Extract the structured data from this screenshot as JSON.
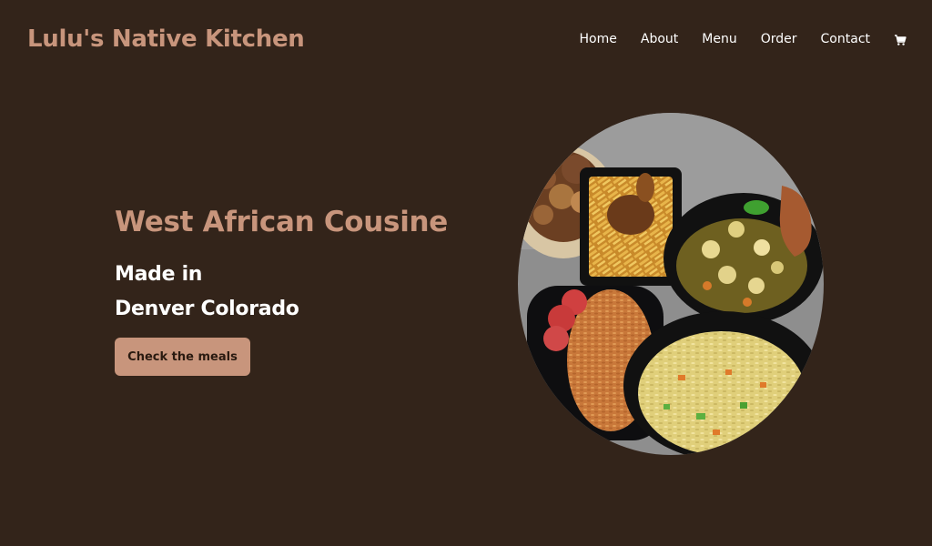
{
  "header": {
    "brand": "Lulu's Native Kitchen",
    "nav": [
      "Home",
      "About",
      "Menu",
      "Order",
      "Contact"
    ],
    "cart_icon": "cart-icon"
  },
  "hero": {
    "title": "West African Cousine",
    "subtitle_line1": "Made in",
    "subtitle_line2": "Denver Colorado",
    "cta_label": "Check the meals",
    "image": "food-platter-image"
  },
  "colors": {
    "background": "#33241a",
    "accent": "#c8957c",
    "text": "#ffffff"
  }
}
